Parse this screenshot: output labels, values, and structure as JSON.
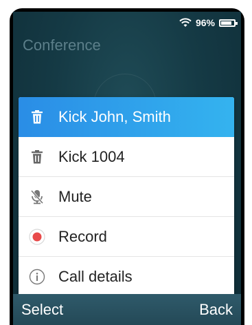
{
  "status": {
    "battery_text": "96%",
    "battery_level": 0.96,
    "icons": [
      "wifi-icon",
      "battery-icon"
    ]
  },
  "screen": {
    "title": "Conference"
  },
  "menu": {
    "items": [
      {
        "label": "Kick John, Smith",
        "icon": "trash-icon",
        "selected": true
      },
      {
        "label": "Kick 1004",
        "icon": "trash-icon",
        "selected": false
      },
      {
        "label": "Mute",
        "icon": "mic-muted-icon",
        "selected": false
      },
      {
        "label": "Record",
        "icon": "record-icon",
        "selected": false
      },
      {
        "label": "Call details",
        "icon": "info-icon",
        "selected": false
      }
    ]
  },
  "softkeys": {
    "left": "Select",
    "right": "Back"
  },
  "colors": {
    "accent": "#2a8de6",
    "record": "#e84a4a",
    "background": "#153a45"
  }
}
